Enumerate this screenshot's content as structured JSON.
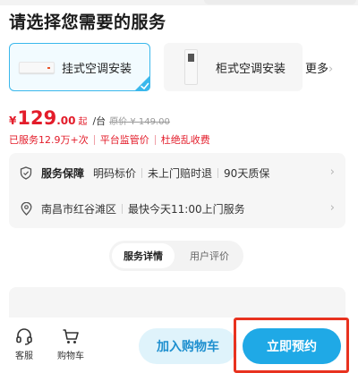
{
  "page_title": "请选择您需要的服务",
  "services": [
    {
      "label": "挂式空调安装",
      "selected": true
    },
    {
      "label": "柜式空调安装",
      "selected": false
    }
  ],
  "more_label": "更多",
  "price": {
    "currency": "¥",
    "integer": "129",
    "decimal": ".00",
    "qi": "起",
    "unit": "/台",
    "original": "原价 ¥ 149.00"
  },
  "tags": [
    "已服务12.9万+次",
    "平台监管价",
    "杜绝乱收费"
  ],
  "guarantee": {
    "title": "服务保障",
    "items": [
      "明码标价",
      "未上门赔时退",
      "90天质保"
    ]
  },
  "location": {
    "address": "南昌市红谷滩区",
    "eta": "最快今天11:00上门服务"
  },
  "tabs": [
    {
      "label": "服务详情",
      "active": true
    },
    {
      "label": "用户评价",
      "active": false
    }
  ],
  "bottom": {
    "kefu": "客服",
    "cart": "购物车",
    "add_cart": "加入购物车",
    "book_now": "立即预约"
  },
  "colors": {
    "accent": "#1fa9e6",
    "price_red": "#e31c2a",
    "highlight_frame": "#e8321f"
  }
}
